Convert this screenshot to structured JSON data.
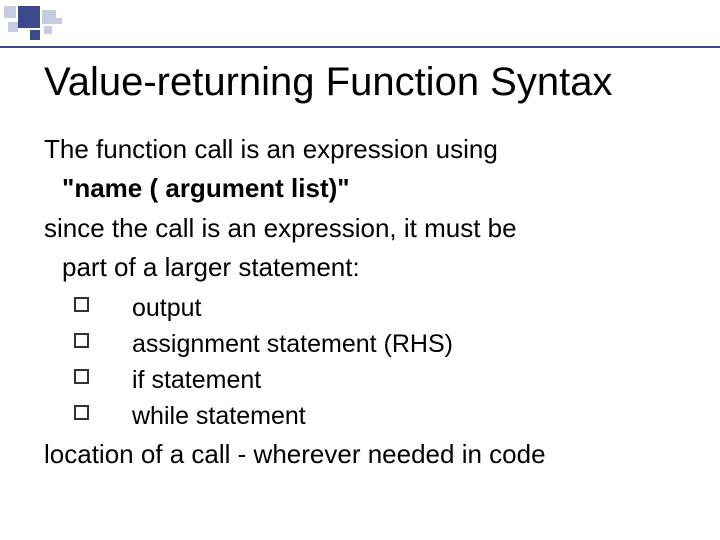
{
  "title": "Value-returning Function Syntax",
  "intro": {
    "line1": "The function call is an expression using",
    "line2_bold": "\"name  ( argument list)\"",
    "line3": "since the call is an expression, it must be",
    "line4": "part of a larger statement:"
  },
  "bullets": [
    "output",
    "assignment statement (RHS)",
    "if statement",
    "while statement"
  ],
  "footer": "location of a call - wherever needed in code"
}
